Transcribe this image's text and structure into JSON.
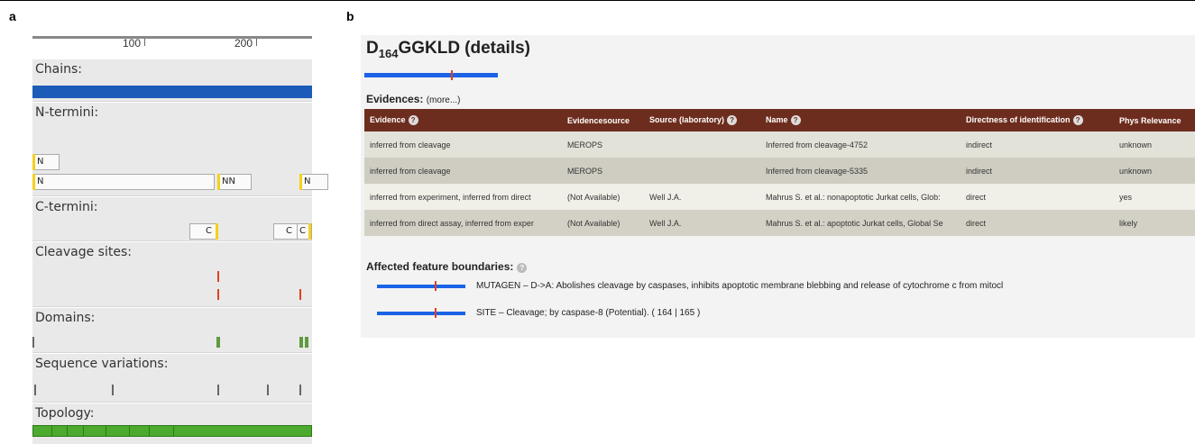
{
  "panel_labels": {
    "a": "a",
    "b": "b"
  },
  "panel_a": {
    "ruler_ticks": [
      "100",
      "200"
    ],
    "tracks": {
      "chains": "Chains:",
      "n_termini": "N-termini:",
      "c_termini": "C-termini:",
      "cleavage_sites": "Cleavage sites:",
      "domains": "Domains:",
      "sequence_variations": "Sequence variations:",
      "topology": "Topology:"
    },
    "n_markers": [
      "N",
      "N",
      "NN",
      "N"
    ],
    "c_markers": [
      "C",
      "C",
      "C"
    ]
  },
  "panel_b": {
    "peptide": {
      "first": "D",
      "position": "164",
      "rest": "GGKLD",
      "details": "(details)"
    },
    "evidences_heading": "Evidences:",
    "more_link": "(more...)",
    "table": {
      "headers": [
        "Evidence",
        "Evidencesource",
        "Source (laboratory)",
        "Name",
        "Directness of identification",
        "Phys Relevance"
      ],
      "rows": [
        [
          "inferred from cleavage",
          "MEROPS",
          "",
          "Inferred from cleavage-4752",
          "indirect",
          "unknown"
        ],
        [
          "inferred from cleavage",
          "MEROPS",
          "",
          "Inferred from cleavage-5335",
          "indirect",
          "unknown"
        ],
        [
          "inferred from experiment, inferred from direct",
          "(Not Available)",
          "Well J.A.",
          "Mahrus S. et al.: nonapoptotic Jurkat cells, Glob:",
          "direct",
          "yes"
        ],
        [
          "inferred from direct assay, inferred from exper",
          "(Not Available)",
          "Well J.A.",
          "Mahrus S. et al.: apoptotic Jurkat cells, Global Se",
          "direct",
          "likely"
        ]
      ]
    },
    "affected_heading": "Affected feature boundaries:",
    "features": [
      "MUTAGEN –    D->A: Abolishes cleavage by caspases, inhibits apoptotic membrane blebbing and release of cytochrome c from mitocl",
      "SITE –    Cleavage; by caspase-8 (Potential). (  164  |    165  )"
    ]
  }
}
